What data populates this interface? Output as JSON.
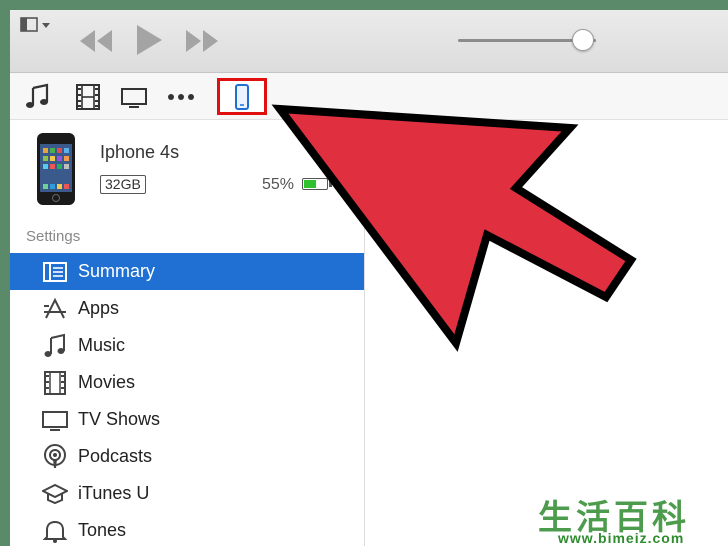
{
  "player": {
    "menu_icon": "sidebar-menu-icon",
    "rewind_icon": "rewind-icon",
    "play_icon": "play-icon",
    "forward_icon": "fast-forward-icon",
    "volume_level": 0.9
  },
  "media_nav": {
    "items": [
      "music-note-icon",
      "film-icon",
      "tv-icon",
      "more-icon",
      "iphone-device-icon"
    ],
    "highlight_color": "#e01010"
  },
  "device": {
    "name": "Iphone 4s",
    "capacity": "32GB",
    "battery": "55%",
    "battery_level": 0.55
  },
  "sidebar": {
    "section_label": "Settings",
    "items": [
      {
        "label": "Summary",
        "icon": "summary-icon",
        "selected": true
      },
      {
        "label": "Apps",
        "icon": "apps-icon"
      },
      {
        "label": "Music",
        "icon": "music-icon"
      },
      {
        "label": "Movies",
        "icon": "movies-icon"
      },
      {
        "label": "TV Shows",
        "icon": "tv-shows-icon"
      },
      {
        "label": "Podcasts",
        "icon": "podcasts-icon"
      },
      {
        "label": "iTunes U",
        "icon": "itunes-u-icon"
      },
      {
        "label": "Tones",
        "icon": "tones-icon"
      }
    ],
    "selected_color": "#1f70d2"
  },
  "annotation": {
    "arrow_color": "#e03040"
  },
  "watermark": {
    "text": "生活百科",
    "url": "www.bimeiz.com"
  }
}
